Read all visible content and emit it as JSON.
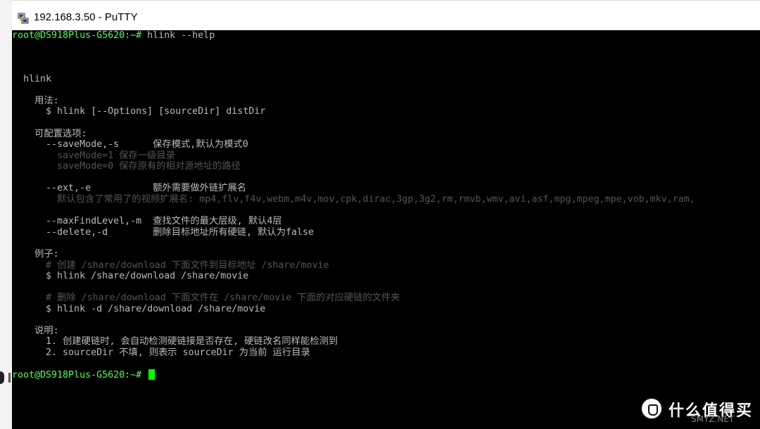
{
  "window": {
    "title": "192.168.3.50 - PuTTY",
    "icon": "putty-icon"
  },
  "terminal": {
    "lines": [
      {
        "prompt": "root@DS918Plus-G5620:~#",
        "text": " hlink --help"
      },
      {
        "text": ""
      },
      {
        "text": "  hlink"
      },
      {
        "text": ""
      },
      {
        "text": "    用法:"
      },
      {
        "text": "      $ hlink [--Options] [sourceDir] distDir"
      },
      {
        "text": ""
      },
      {
        "text": "    可配置选项:"
      },
      {
        "text": "      --saveMode,-s      保存模式,默认为模式0"
      },
      {
        "dim": "        saveMode=1 保存一级目录"
      },
      {
        "dim": "        saveMode=0 保存原有的相对源地址的路径"
      },
      {
        "text": ""
      },
      {
        "text": "      --ext,-e           额外需要做外链扩展名"
      },
      {
        "dim": "        默认包含了常用了的视频扩展名: mp4,flv,f4v,webm,m4v,mov,cpk,dirac,3gp,3g2,rm,rmvb,wmv,avi,asf,mpg,mpeg,mpe,vob,mkv,ram,"
      },
      {
        "text": ""
      },
      {
        "text": "      --maxFindLevel,-m  查找文件的最大层级, 默认4层"
      },
      {
        "text": "      --delete,-d        删除目标地址所有硬链, 默认为false"
      },
      {
        "text": ""
      },
      {
        "text": "    例子:"
      },
      {
        "dim": "      # 创建 /share/download 下面文件到目标地址 /share/movie"
      },
      {
        "text": "      $ hlink /share/download /share/movie"
      },
      {
        "text": ""
      },
      {
        "dim": "      # 删除 /share/download 下面文件在 /share/movie 下面的对应硬链的文件夹"
      },
      {
        "text": "      $ hlink -d /share/download /share/movie"
      },
      {
        "text": ""
      },
      {
        "text": "    说明:"
      },
      {
        "text": "      1. 创建硬链时, 会自动检测硬链接是否存在, 硬链改名同样能检测到"
      },
      {
        "text": "      2. sourceDir 不填, 则表示 sourceDir 为当前 运行目录"
      },
      {
        "text": ""
      },
      {
        "prompt": "root@DS918Plus-G5620:~#",
        "text": " ",
        "cursor": true
      }
    ]
  },
  "watermark": {
    "text": "什么值得买",
    "sub": "SMYZ.NET",
    "icon": "smzdm-logo-icon"
  }
}
